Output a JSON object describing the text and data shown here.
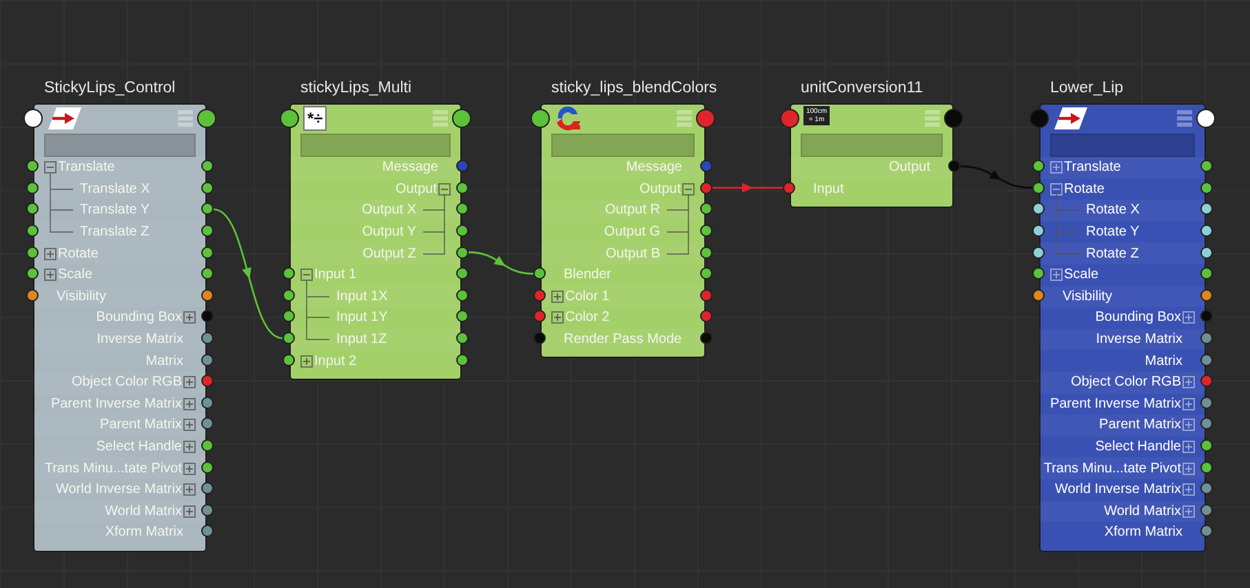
{
  "nodes": [
    {
      "title": "StickyLips_Control",
      "color": "#aab7be",
      "icon": {
        "kind": "transform"
      },
      "header_ports": [
        {
          "kind": "input",
          "color": "#ffffff"
        },
        {
          "kind": "output",
          "color": "#5cc23a"
        }
      ],
      "rows": [
        {
          "label": "Translate",
          "kind": "inout",
          "color": "#5cc23a",
          "expanded": true,
          "children": [
            {
              "label": "Translate X",
              "kind": "inout",
              "color": "#5cc23a"
            },
            {
              "label": "Translate Y",
              "kind": "inout",
              "color": "#5cc23a"
            },
            {
              "label": "Translate Z",
              "kind": "inout",
              "color": "#5cc23a"
            }
          ]
        },
        {
          "label": "Rotate",
          "kind": "inout",
          "color": "#5cc23a",
          "expanded": false
        },
        {
          "label": "Scale",
          "kind": "inout",
          "color": "#5cc23a",
          "expanded": false
        },
        {
          "label": "Visibility",
          "kind": "inout",
          "color": "#e0861f"
        },
        {
          "label": "Bounding Box",
          "kind": "output",
          "color": "#0a0a0a",
          "expanded": false
        },
        {
          "label": "Inverse Matrix",
          "kind": "output",
          "color": "#6f9196"
        },
        {
          "label": "Matrix",
          "kind": "output",
          "color": "#6f9196"
        },
        {
          "label": "Object Color RGB",
          "kind": "output",
          "color": "#e0242c",
          "expanded": false
        },
        {
          "label": "Parent Inverse Matrix",
          "kind": "output",
          "color": "#6f9196",
          "expanded": false
        },
        {
          "label": "Parent Matrix",
          "kind": "output",
          "color": "#6f9196",
          "expanded": false
        },
        {
          "label": "Select Handle",
          "kind": "output",
          "color": "#5cc23a",
          "expanded": false
        },
        {
          "label": "Trans Minu...tate Pivot",
          "kind": "output",
          "color": "#5cc23a",
          "expanded": false
        },
        {
          "label": "World Inverse Matrix",
          "kind": "output",
          "color": "#6f9196",
          "expanded": false
        },
        {
          "label": "World Matrix",
          "kind": "output",
          "color": "#6f9196",
          "expanded": false
        },
        {
          "label": "Xform Matrix",
          "kind": "output",
          "color": "#6f9196"
        }
      ]
    },
    {
      "title": "stickyLips_Multi",
      "color": "#a4d06a",
      "icon": {
        "kind": "multiply",
        "text": "*÷"
      },
      "header_ports": [
        {
          "kind": "input",
          "color": "#5cc23a"
        },
        {
          "kind": "output",
          "color": "#5cc23a"
        }
      ],
      "rows": [
        {
          "label": "Message",
          "kind": "output",
          "color": "#2a46b8"
        },
        {
          "label": "Output",
          "kind": "output",
          "color": "#5cc23a",
          "expanded": true,
          "children": [
            {
              "label": "Output X",
              "kind": "output",
              "color": "#5cc23a"
            },
            {
              "label": "Output Y",
              "kind": "output",
              "color": "#5cc23a"
            },
            {
              "label": "Output Z",
              "kind": "output",
              "color": "#5cc23a"
            }
          ]
        },
        {
          "label": "Input 1",
          "kind": "inout",
          "color": "#5cc23a",
          "expanded": true,
          "children": [
            {
              "label": "Input 1X",
              "kind": "inout",
              "color": "#5cc23a"
            },
            {
              "label": "Input 1Y",
              "kind": "inout",
              "color": "#5cc23a"
            },
            {
              "label": "Input 1Z",
              "kind": "inout",
              "color": "#5cc23a"
            }
          ]
        },
        {
          "label": "Input 2",
          "kind": "inout",
          "color": "#5cc23a",
          "expanded": false
        }
      ]
    },
    {
      "title": "sticky_lips_blendColors",
      "color": "#a4d06a",
      "icon": {
        "kind": "blend"
      },
      "header_ports": [
        {
          "kind": "input",
          "color": "#5cc23a"
        },
        {
          "kind": "output",
          "color": "#e0242c"
        }
      ],
      "rows": [
        {
          "label": "Message",
          "kind": "output",
          "color": "#2a46b8"
        },
        {
          "label": "Output",
          "kind": "output",
          "color": "#e0242c",
          "expanded": true,
          "children": [
            {
              "label": "Output R",
              "kind": "output",
              "color": "#5cc23a"
            },
            {
              "label": "Output G",
              "kind": "output",
              "color": "#5cc23a"
            },
            {
              "label": "Output B",
              "kind": "output",
              "color": "#5cc23a"
            }
          ]
        },
        {
          "label": "Blender",
          "kind": "inout",
          "color": "#5cc23a"
        },
        {
          "label": "Color 1",
          "kind": "inout",
          "color": "#e0242c",
          "expanded": false
        },
        {
          "label": "Color 2",
          "kind": "inout",
          "color": "#e0242c",
          "expanded": false
        },
        {
          "label": "Render Pass Mode",
          "kind": "inout",
          "color": "#0a0a0a"
        }
      ]
    },
    {
      "title": "unitConversion11",
      "color": "#a4d06a",
      "icon": {
        "kind": "unit",
        "text": "100cm",
        "subtext": "= 1m"
      },
      "header_ports": [
        {
          "kind": "input",
          "color": "#e0242c"
        },
        {
          "kind": "output",
          "color": "#0a0a0a"
        }
      ],
      "rows": [
        {
          "label": "Output",
          "kind": "output",
          "color": "#0a0a0a"
        },
        {
          "label": "Input",
          "kind": "input",
          "color": "#e0242c"
        }
      ]
    },
    {
      "title": "Lower_Lip",
      "color": "#3a51b4",
      "icon": {
        "kind": "transform"
      },
      "header_ports": [
        {
          "kind": "input",
          "color": "#0a0a0a"
        },
        {
          "kind": "output",
          "color": "#ffffff"
        }
      ],
      "rows": [
        {
          "label": "Translate",
          "kind": "inout",
          "color": "#5cc23a",
          "expanded": false
        },
        {
          "label": "Rotate",
          "kind": "inout",
          "color": "#5cc23a",
          "expanded": true,
          "children": [
            {
              "label": "Rotate X",
              "kind": "inout",
              "color": "#8ccfd8"
            },
            {
              "label": "Rotate Y",
              "kind": "inout",
              "color": "#8ccfd8"
            },
            {
              "label": "Rotate Z",
              "kind": "inout",
              "color": "#8ccfd8"
            }
          ]
        },
        {
          "label": "Scale",
          "kind": "inout",
          "color": "#5cc23a",
          "expanded": false
        },
        {
          "label": "Visibility",
          "kind": "inout",
          "color": "#e0861f"
        },
        {
          "label": "Bounding Box",
          "kind": "output",
          "color": "#0a0a0a",
          "expanded": false
        },
        {
          "label": "Inverse Matrix",
          "kind": "output",
          "color": "#6f9196"
        },
        {
          "label": "Matrix",
          "kind": "output",
          "color": "#6f9196"
        },
        {
          "label": "Object Color RGB",
          "kind": "output",
          "color": "#e0242c",
          "expanded": false
        },
        {
          "label": "Parent Inverse Matrix",
          "kind": "output",
          "color": "#6f9196",
          "expanded": false
        },
        {
          "label": "Parent Matrix",
          "kind": "output",
          "color": "#6f9196",
          "expanded": false
        },
        {
          "label": "Select Handle",
          "kind": "output",
          "color": "#5cc23a",
          "expanded": false
        },
        {
          "label": "Trans Minu...tate Pivot",
          "kind": "output",
          "color": "#5cc23a",
          "expanded": false
        },
        {
          "label": "World Inverse Matrix",
          "kind": "output",
          "color": "#6f9196",
          "expanded": false
        },
        {
          "label": "World Matrix",
          "kind": "output",
          "color": "#6f9196",
          "expanded": false
        },
        {
          "label": "Xform Matrix",
          "kind": "output",
          "color": "#6f9196"
        }
      ]
    }
  ]
}
